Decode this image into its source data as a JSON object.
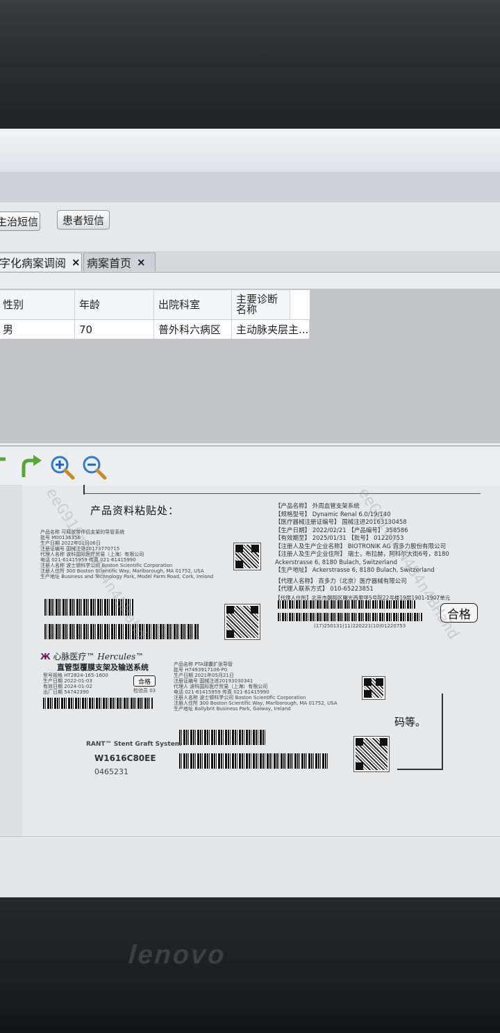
{
  "toolbar": {
    "btn_doctor_sms": "主治短信",
    "btn_patient_sms": "患者短信"
  },
  "tabs": [
    {
      "label": "字化病案调阅"
    },
    {
      "label": "病案首页"
    }
  ],
  "tab_close": "×",
  "grid": {
    "headers": [
      "性别",
      "年龄",
      "出院科室",
      "主要诊断名称"
    ],
    "row": [
      "男",
      "70",
      "普外科六病区",
      "主动脉夹层主..."
    ]
  },
  "document": {
    "section_title": "产品资料粘贴处：",
    "right_label": {
      "fields": [
        [
          "【产品名称】",
          "外周血管支架系统"
        ],
        [
          "【规格型号】",
          "Dynamic Renal 6.0/19/140"
        ],
        [
          "【医疗器械注册证编号】",
          "国械注进20163130458"
        ],
        [
          "【生产日期】",
          "2022/02/21"
        ],
        [
          "【有效期至】",
          "2025/01/31"
        ],
        [
          "【注册人及生产企业名称】",
          "BIOTRONIK AG 百多力股份有限公司"
        ],
        [
          "【注册人及生产企业住所】",
          "瑞士，布拉赫，阿科尔大街6号，8180"
        ],
        [
          "",
          "Ackerstrasse 6, 8180 Bulach, Switzerland"
        ],
        [
          "【生产地址】",
          "Ackerstrasse 6, 8180 Bulach, Switzerland"
        ],
        [
          "【代理人名称】",
          "百多力（北京）医疗器械有限公司"
        ],
        [
          "【代理人联系方式】",
          "010-65223851"
        ],
        [
          "【代理人住所】",
          "北京市朝阳区曙光西里甲5号院22号楼19层1901-1907单元"
        ]
      ],
      "product_no": "【产品编号】 358586",
      "lot_no": "【批号】 01220753",
      "barcode_caption": "(17)250131(11)220221(10)01220753"
    },
    "stamp_text": "合格",
    "mid_label": {
      "brand_cn": "心脉医疗",
      "brand_en": "Hercules",
      "product_cn": "直管型覆膜支架及输送系统",
      "fields": [
        "型号规格  HT2824-165-1600",
        "生产日期  2022-01-03",
        "有效日期  2024-01-02",
        "出厂日期  54742390"
      ],
      "stamp": "合格",
      "inspector": "检验员 03"
    },
    "lower_text_1": "RANT™ Stent Graft System",
    "lower_text_2": "W1616C80EE",
    "lower_text_3": "0465231",
    "right_partial": "码等。",
    "small_label_1": [
      "产品名称  可释放带伴侣支架的导管系统",
      "批号  M00136356",
      "生产日期  2022年01月06日",
      "注册证编号  国械注进20173770715",
      "代理人名称  波科国际医疗贸易（上海）有限公司",
      "电话  021-61415959   传真  021-61415990",
      "注册人名称  波士顿科学公司 Boston Scientific Corporation",
      "注册人住所  300 Boston Scientific Way, Marlborough, MA 01752, USA",
      "生产地址  Business and Technology Park, Model Farm Road, Cork, Ireland"
    ],
    "small_label_2": [
      "产品名称  PTA球囊扩张导管",
      "批号  H7493917106-P0",
      "生产日期  2021年05月21日",
      "注册证编号  国械注进20193030341",
      "代理人  波科国际医疗贸易（上海）有限公司",
      "电话  021-61415959   传真  021-61415990",
      "注册人名称  波士顿科学公司 Boston Scientific Corporation",
      "注册人住所  300 Boston Scientific Way, Marlborough, MA 01752, USA",
      "生产地址  Ballybrit Business Park, Galway, Ireland"
    ],
    "watermark": "eeG916mmN4B4n4BHahd"
  }
}
